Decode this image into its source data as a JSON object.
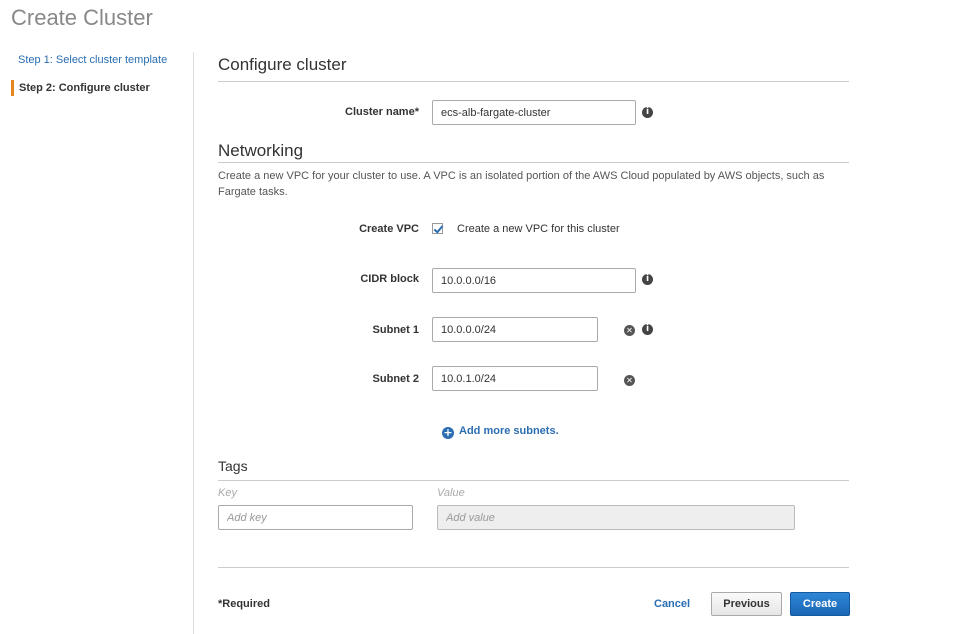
{
  "page": {
    "title": "Create Cluster"
  },
  "sidebar": {
    "steps": [
      {
        "label": "Step 1: Select cluster template"
      },
      {
        "label": "Step 2: Configure cluster"
      }
    ]
  },
  "configure": {
    "title": "Configure cluster",
    "cluster_name_label": "Cluster name*",
    "cluster_name_value": "ecs-alb-fargate-cluster"
  },
  "networking": {
    "title": "Networking",
    "description": "Create a new VPC for your cluster to use. A VPC is an isolated portion of the AWS Cloud populated by AWS objects, such as Fargate tasks.",
    "create_vpc_label": "Create VPC",
    "create_vpc_checkbox_label": "Create a new VPC for this cluster",
    "create_vpc_checked": true,
    "cidr_label": "CIDR block",
    "cidr_value": "10.0.0.0/16",
    "subnet1_label": "Subnet 1",
    "subnet1_value": "10.0.0.0/24",
    "subnet2_label": "Subnet 2",
    "subnet2_value": "10.0.1.0/24",
    "add_subnets_label": "Add more subnets."
  },
  "tags": {
    "title": "Tags",
    "key_header": "Key",
    "value_header": "Value",
    "key_placeholder": "Add key",
    "value_placeholder": "Add value"
  },
  "footer": {
    "required_label": "*Required",
    "cancel_label": "Cancel",
    "previous_label": "Previous",
    "create_label": "Create"
  },
  "colors": {
    "link": "#2a6db0",
    "primary_button": "#1a66b5",
    "active_step_accent": "#e6861c"
  },
  "icons": {
    "info": "info-icon",
    "remove": "remove-icon",
    "add": "plus-circle-icon"
  }
}
